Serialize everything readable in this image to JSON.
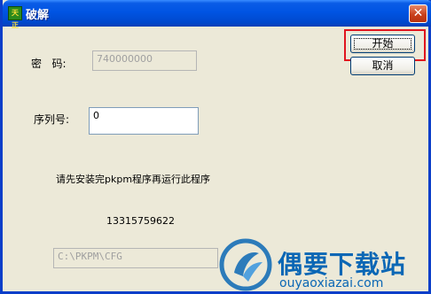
{
  "window": {
    "title": "破解",
    "app_icon_text": "天正",
    "close_symbol": "✕"
  },
  "form": {
    "password_label": "密   码:",
    "password_value": "740000000",
    "serial_label": "序列号:",
    "serial_value": "0",
    "instruction": "请先安装完pkpm程序再运行此程序",
    "code": "13315759622",
    "path_value": "C:\\PKPM\\CFG"
  },
  "buttons": {
    "start": "开始",
    "cancel": "取消"
  },
  "watermark": {
    "title": "偶要下载站",
    "url": "ouyaoxiazai.com"
  },
  "colors": {
    "titlebar": "#0054e3",
    "highlight": "#e0141e",
    "watermark": "#0b67b5"
  }
}
